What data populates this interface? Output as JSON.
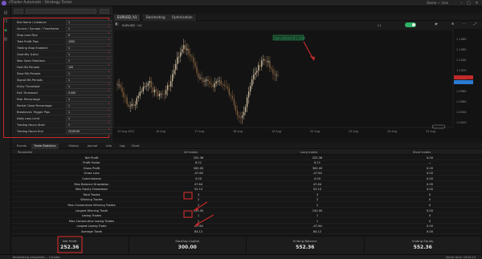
{
  "titlebar": {
    "title": "cTrader Automate - Strategy Tester",
    "account": "Demo  —  Live",
    "minimize": "–",
    "maximize": "□",
    "close": "×"
  },
  "rail": [
    {
      "icon": "trade-icon"
    },
    {
      "icon": "copy-icon"
    },
    {
      "icon": "automate-icon"
    },
    {
      "icon": "analyze-icon"
    }
  ],
  "params": [
    {
      "label": "Bot Name / Instance",
      "value": "1"
    },
    {
      "label": "Source / Symbol / Timeframe",
      "value": "1"
    },
    {
      "label": "Stop Loss Pips",
      "value": "0"
    },
    {
      "label": "Take Profit Pips",
      "value": "1000"
    },
    {
      "label": "Trailing Stop Enabled",
      "value": "1"
    },
    {
      "label": "Quantity (Lots)",
      "value": "1"
    },
    {
      "label": "Max Open Positions",
      "value": "1"
    },
    {
      "label": "Fast MA Periods",
      "value": "100"
    },
    {
      "label": "Slow MA Periods",
      "value": "1"
    },
    {
      "label": "Signal MA Periods",
      "value": "1"
    },
    {
      "label": "Entry Threshold",
      "value": "1"
    },
    {
      "label": "Exit Threshold",
      "value": "0.000"
    },
    {
      "label": "Risk Percentage",
      "value": "1"
    },
    {
      "label": "Partial Close Percentage",
      "value": "1"
    },
    {
      "label": "Breakeven Trigger Pips",
      "value": "1"
    },
    {
      "label": "Daily Loss Limit",
      "value": "1"
    },
    {
      "label": "Trading Hours Start",
      "value": "1"
    },
    {
      "label": "Trading Hours End",
      "value": "23:59:59"
    }
  ],
  "chart": {
    "tabs": [
      "EURUSD, h1",
      "Backtesting",
      "Optimization"
    ],
    "symbol_label": "EURUSD · h1",
    "annotation": "Sell 1.00 lots @ 1.1032",
    "timeframe": "h1",
    "price_labels": [
      "1.1080",
      "1.1060",
      "1.1040",
      "1.1020",
      "1.1000",
      "1.0980",
      "1.0960",
      "1.0940",
      "1.0920"
    ],
    "time_labels": [
      "13 Aug 2021",
      "16 Aug",
      "17 Aug",
      "18 Aug",
      "19 Aug",
      "20 Aug",
      "23 Aug",
      "24 Aug",
      "25 Aug"
    ],
    "accent_green": "#2fb26a",
    "accent_red": "#c42a2a"
  },
  "bottom_tabs": [
    "Events",
    "Trade Statistics",
    "History",
    "Journal",
    "Info",
    "Log",
    "Chart"
  ],
  "results": {
    "headers": [
      "Parameter",
      "All trades",
      "Long trades",
      "Short trades"
    ],
    "rows": [
      {
        "label": "Net Profit",
        "all": "252.36",
        "long": "252.36",
        "short": "0.00"
      },
      {
        "label": "Profit Factor",
        "all": "6.21",
        "long": "6.21",
        "short": "—"
      },
      {
        "label": "Gross Profit",
        "all": "300.00",
        "long": "300.00",
        "short": "0.00"
      },
      {
        "label": "Gross Loss",
        "all": "-47.64",
        "long": "-47.64",
        "short": "0.00"
      },
      {
        "label": "Commissions",
        "all": "0.00",
        "long": "0.00",
        "short": "0.00"
      },
      {
        "label": "Max Balance Drawdown",
        "all": "47.64",
        "long": "47.64",
        "short": "0.00"
      },
      {
        "label": "Max Equity Drawdown",
        "all": "52.10",
        "long": "52.10",
        "short": "0.00"
      },
      {
        "label": "Total Trades",
        "all": "3",
        "long": "3",
        "short": "0"
      },
      {
        "label": "Winning Trades",
        "all": "2",
        "long": "2",
        "short": "0"
      },
      {
        "label": "Max Consecutive Winning Trades",
        "all": "2",
        "long": "2",
        "short": "0"
      },
      {
        "label": "Largest Winning Trade",
        "all": "150.00",
        "long": "150.00",
        "short": "0.00"
      },
      {
        "label": "Losing Trades",
        "all": "1",
        "long": "1",
        "short": "0"
      },
      {
        "label": "Max Consecutive Losing Trades",
        "all": "1",
        "long": "1",
        "short": "0"
      },
      {
        "label": "Largest Losing Trade",
        "all": "-47.64",
        "long": "-47.64",
        "short": "0.00"
      },
      {
        "label": "Average Trade",
        "all": "84.12",
        "long": "84.12",
        "short": "0.00"
      }
    ]
  },
  "summary": [
    {
      "label": "Net Profit",
      "value": "252.36"
    },
    {
      "label": "Starting Capital",
      "value": "300.00"
    },
    {
      "label": "Ending Balance",
      "value": "552.36"
    },
    {
      "label": "Ending Equity",
      "value": "552.36"
    }
  ],
  "status": {
    "left": "Backtesting completed — 3 trades",
    "right": "Server time: 16:42:10"
  }
}
